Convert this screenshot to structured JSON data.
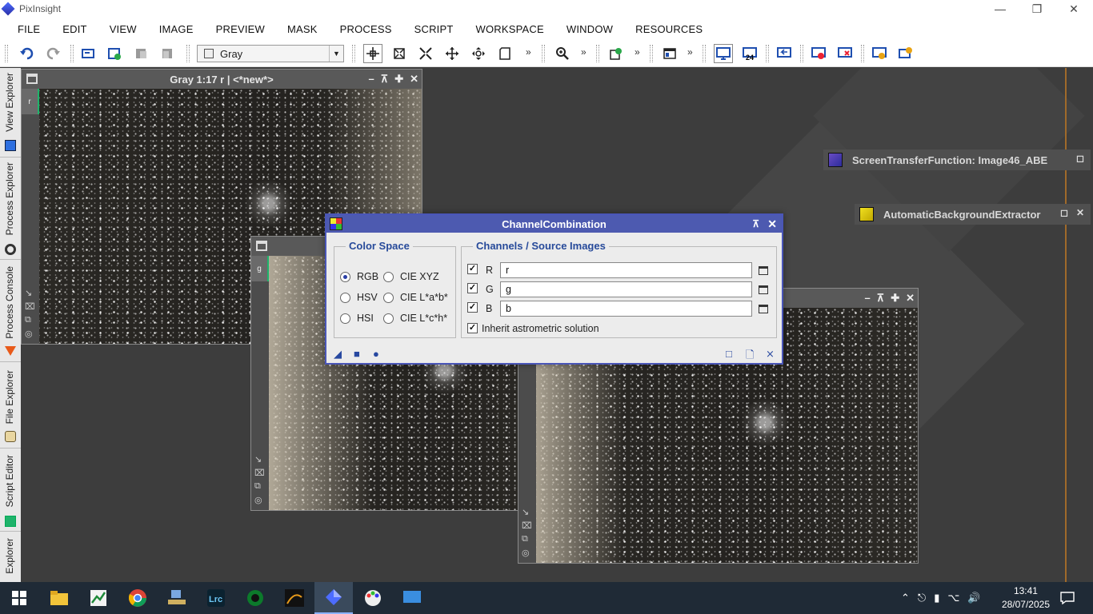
{
  "app": {
    "title": "PixInsight"
  },
  "menu": [
    "FILE",
    "EDIT",
    "VIEW",
    "IMAGE",
    "PREVIEW",
    "MASK",
    "PROCESS",
    "SCRIPT",
    "WORKSPACE",
    "WINDOW",
    "RESOURCES"
  ],
  "toolbar": {
    "view_selector_value": "Gray",
    "more_chevron": "»"
  },
  "side_tabs": [
    "View Explorer",
    "Process Explorer",
    "Process Console",
    "File Explorer",
    "Script Editor",
    "Explorer"
  ],
  "windows": {
    "gray": {
      "title": "Gray 1:17 r | <*new*>",
      "view_tag": "r"
    },
    "mid": {
      "view_tag": "g"
    },
    "front": {
      "title": ""
    }
  },
  "process_icons": {
    "stf": {
      "label": "ScreenTransferFunction: Image46_ABE"
    },
    "abe": {
      "label": "AutomaticBackgroundExtractor"
    }
  },
  "dialog": {
    "title": "ChannelCombination",
    "color_space": {
      "title": "Color Space",
      "options": [
        "RGB",
        "CIE XYZ",
        "HSV",
        "CIE L*a*b*",
        "HSI",
        "CIE L*c*h*"
      ],
      "selected": "RGB"
    },
    "channels": {
      "title": "Channels / Source Images",
      "rows": [
        {
          "label": "R",
          "value": "r",
          "checked": true
        },
        {
          "label": "G",
          "value": "g",
          "checked": true
        },
        {
          "label": "B",
          "value": "b",
          "checked": true
        }
      ],
      "inherit_label": "Inherit astrometric solution",
      "inherit_checked": true
    }
  },
  "taskbar": {
    "time": "13:41",
    "date": "28/07/2025"
  },
  "colors": {
    "dialog_title": "#4d5ab0",
    "group_title": "#274a9a",
    "accent_green": "#1fb36b"
  }
}
